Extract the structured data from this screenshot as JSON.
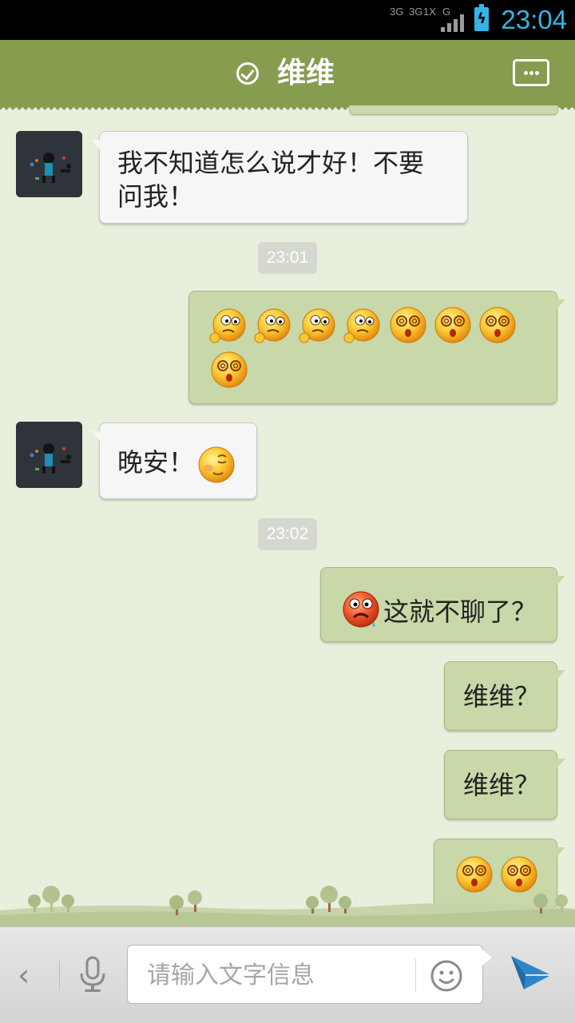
{
  "status_bar": {
    "network_labels": [
      "3G",
      "3G",
      "1X",
      "G"
    ],
    "time": "23:04",
    "battery_icon": "battery-charging-icon",
    "accent_color": "#33b5e5"
  },
  "header": {
    "title": "维维",
    "status_icon": "verified-check-icon",
    "menu_icon": "chat-menu-icon",
    "color": "#869c4f"
  },
  "messages": [
    {
      "side": "left",
      "text_lines": [
        "我不知道怎么说才好！不要",
        "问我！"
      ]
    },
    {
      "type": "time",
      "text": "23:01"
    },
    {
      "side": "right",
      "emoticons": [
        "confused-face-icon",
        "confused-face-icon",
        "confused-face-icon",
        "confused-face-icon",
        "dizzy-face-icon",
        "dizzy-face-icon",
        "dizzy-face-icon",
        "dizzy-face-icon"
      ]
    },
    {
      "side": "left",
      "text": "晚安！",
      "emoticon": "sleepy-face-icon"
    },
    {
      "type": "time",
      "text": "23:02"
    },
    {
      "side": "right",
      "text": "这就不聊了？",
      "emoticon": "crying-angry-face-icon"
    },
    {
      "side": "right",
      "text": "维维？"
    },
    {
      "side": "right",
      "text": "维维？"
    },
    {
      "side": "right",
      "emoticons": [
        "dizzy-face-icon",
        "dizzy-face-icon"
      ]
    }
  ],
  "input_bar": {
    "back_icon": "chevron-left-icon",
    "mic_icon": "microphone-icon",
    "placeholder": "请输入文字信息",
    "emoji_icon": "smiley-icon",
    "send_icon": "send-icon"
  }
}
